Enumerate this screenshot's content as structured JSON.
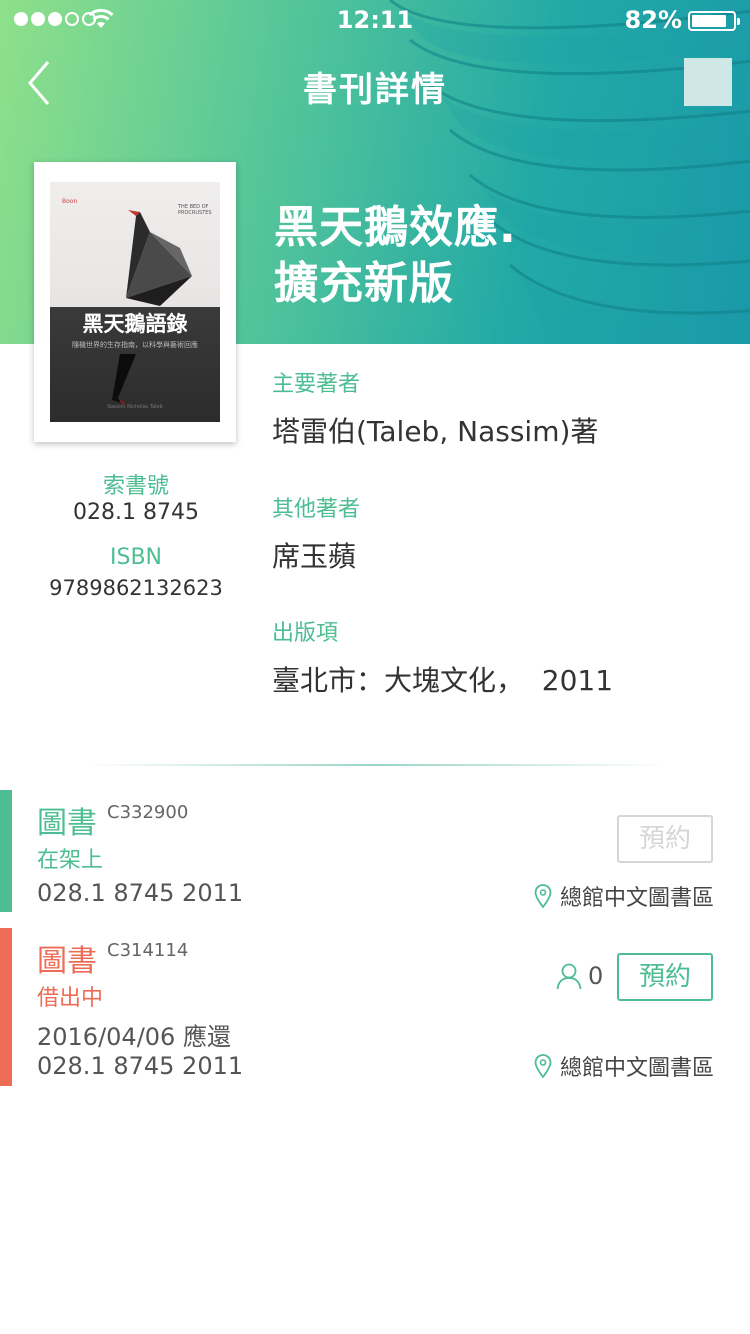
{
  "status_bar": {
    "time": "12:11",
    "battery": "82%"
  },
  "nav": {
    "title": "書刊詳情"
  },
  "book": {
    "title_line1": "黑天鵝效應.",
    "title_line2": "擴充新版",
    "cover": {
      "title": "黑天鵝語錄",
      "subtitle": "隨機世界的生存指南，以科學與藝術回應",
      "english": "THE BED OF PROCRUSTES",
      "publisher_mark": "Boon",
      "bottom_text": "Nassim Nicholas Taleb"
    }
  },
  "identifiers": {
    "call_label": "索書號",
    "call_value": "028.1 8745",
    "isbn_label": "ISBN",
    "isbn_value": "9789862132623"
  },
  "meta": {
    "author_label": "主要著者",
    "author_value": "塔雷伯(Taleb, Nassim)著",
    "other_label": "其他著者",
    "other_value": "席玉蘋",
    "pub_label": "出版項",
    "pub_value": "臺北市：大塊文化，  2011"
  },
  "holdings": [
    {
      "type": "圖書",
      "barcode": "C332900",
      "status": "在架上",
      "call": "028.1 8745 2011",
      "location": "總館中文圖書區",
      "reserve_label": "預約",
      "color": "#4dbd93"
    },
    {
      "type": "圖書",
      "barcode": "C314114",
      "status": "借出中",
      "due": "2016/04/06 應還",
      "call": "028.1 8745 2011",
      "location": "總館中文圖書區",
      "reserve_label": "預約",
      "holds_count": "0",
      "color": "#ee6c55"
    }
  ],
  "colors": {
    "accent": "#4dbd93",
    "borrowed": "#ee6c55",
    "disabled": "#d6d6d6"
  }
}
